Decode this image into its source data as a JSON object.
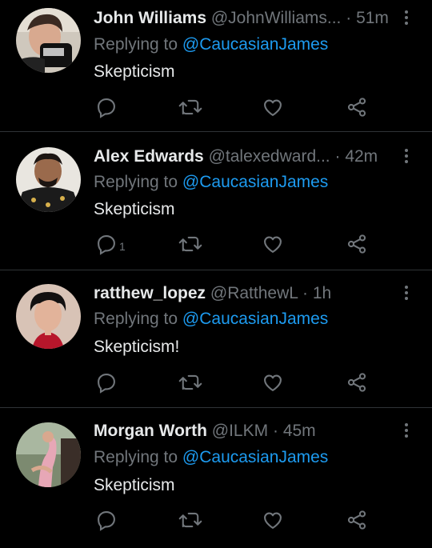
{
  "tweets": [
    {
      "name": "John Williams",
      "handle": "@JohnWilliams...",
      "separator": "·",
      "time": "51m",
      "replying_prefix": "Replying to",
      "replying_to": "@CaucasianJames",
      "text": "Skepticism",
      "reply_count": ""
    },
    {
      "name": "Alex Edwards",
      "handle": "@talexedward...",
      "separator": "·",
      "time": "42m",
      "replying_prefix": "Replying to",
      "replying_to": "@CaucasianJames",
      "text": "Skepticism",
      "reply_count": "1"
    },
    {
      "name": "ratthew_lopez",
      "handle": "@RatthewL",
      "separator": "·",
      "time": "1h",
      "replying_prefix": "Replying to",
      "replying_to": "@CaucasianJames",
      "text": "Skepticism!",
      "reply_count": ""
    },
    {
      "name": "Morgan Worth",
      "handle": "@ILKM",
      "separator": "·",
      "time": "45m",
      "replying_prefix": "Replying to",
      "replying_to": "@CaucasianJames",
      "text": "Skepticism",
      "reply_count": ""
    }
  ],
  "icons": {
    "reply": "reply-icon",
    "retweet": "retweet-icon",
    "like": "heart-icon",
    "share": "share-icon",
    "more": "more-icon"
  },
  "colors": {
    "background": "#000000",
    "primary_text": "#e7e9ea",
    "secondary_text": "#71767b",
    "mention": "#1d9bf0",
    "divider": "#2f3336"
  }
}
